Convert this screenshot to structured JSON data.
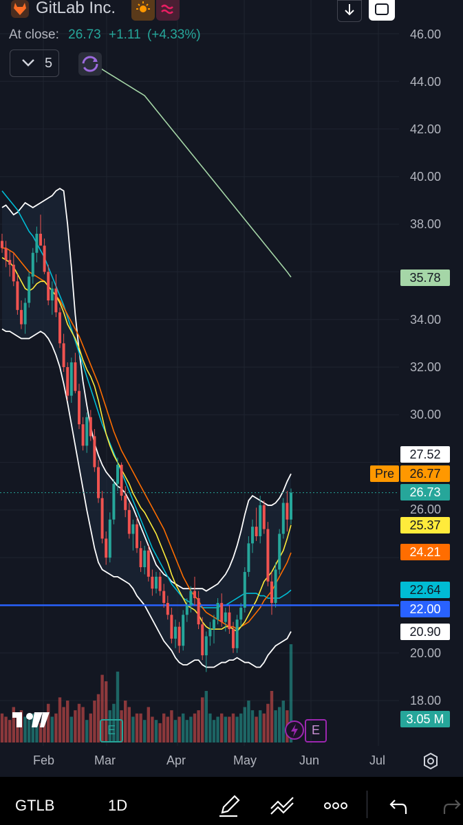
{
  "header": {
    "company": "GitLab Inc.",
    "at_close_label": "At close:",
    "close_price": "26.73",
    "change": "+1.11",
    "change_pct": "(+4.33%)",
    "interval_count": "5",
    "session_icon": "sun-icon",
    "wave_icon": "wave-icon",
    "download_icon": "download-icon",
    "fullscreen_icon": "fullscreen-icon"
  },
  "price_axis": [
    "46.00",
    "44.00",
    "42.00",
    "40.00",
    "38.00",
    "34.00",
    "32.00",
    "30.00",
    "26.00",
    "20.00",
    "18.00"
  ],
  "time_axis": [
    "Feb",
    "Mar",
    "Apr",
    "May",
    "Jun",
    "Jul"
  ],
  "tags": {
    "sma200": "35.78",
    "upper_band": "27.52",
    "pre_label": "Pre",
    "pre_price": "26.77",
    "last": "26.73",
    "ma10": "25.37",
    "ma20": "24.21",
    "ma50": "22.64",
    "hline": "22.00",
    "lower_band": "20.90",
    "volume": "3.05 M"
  },
  "colors": {
    "up": "#26a69a",
    "down": "#ef5350",
    "ma10": "#ffeb3b",
    "ma20": "#ff6d00",
    "ma50": "#00bcd4",
    "sma200": "#a5d6a7",
    "bands": "#ffffff",
    "hline": "#2962ff",
    "pre": "#ff9800",
    "earnings": "#9c27b0"
  },
  "earnings_marker": "E",
  "bottom_bar": {
    "ticker": "GTLB",
    "interval": "1D",
    "icons": [
      "pencil-icon",
      "trend-line-icon",
      "more-icon",
      "undo-icon",
      "redo-icon"
    ]
  },
  "chart_data": {
    "type": "candlestick",
    "ylim": [
      17.0,
      47.0
    ],
    "x_ticks": [
      "Feb",
      "Mar",
      "Apr",
      "May",
      "Jun",
      "Jul"
    ],
    "candles": [
      [
        37.3,
        37.6,
        36.8,
        37.0
      ],
      [
        37.0,
        37.3,
        36.2,
        36.5
      ],
      [
        36.5,
        36.9,
        35.8,
        36.3
      ],
      [
        36.3,
        36.8,
        35.4,
        35.6
      ],
      [
        35.6,
        35.9,
        34.2,
        34.4
      ],
      [
        34.4,
        34.8,
        33.6,
        33.8
      ],
      [
        33.8,
        34.9,
        33.4,
        34.7
      ],
      [
        34.7,
        36.0,
        34.5,
        35.8
      ],
      [
        35.8,
        37.0,
        35.5,
        36.8
      ],
      [
        36.8,
        37.9,
        36.4,
        37.6
      ],
      [
        37.6,
        38.4,
        37.2,
        37.1
      ],
      [
        37.1,
        37.4,
        35.9,
        36.0
      ],
      [
        36.0,
        36.3,
        34.6,
        34.8
      ],
      [
        34.8,
        35.6,
        34.2,
        35.3
      ],
      [
        35.3,
        35.9,
        34.1,
        34.3
      ],
      [
        34.3,
        34.5,
        32.8,
        33.0
      ],
      [
        33.0,
        33.4,
        31.8,
        32.0
      ],
      [
        32.0,
        32.2,
        30.6,
        30.8
      ],
      [
        30.8,
        32.4,
        30.5,
        32.2
      ],
      [
        32.2,
        32.6,
        30.9,
        31.0
      ],
      [
        31.0,
        31.3,
        29.4,
        29.6
      ],
      [
        29.6,
        29.9,
        28.5,
        28.7
      ],
      [
        28.7,
        30.1,
        28.4,
        29.9
      ],
      [
        29.9,
        30.2,
        28.9,
        29.1
      ],
      [
        29.1,
        29.4,
        27.6,
        27.8
      ],
      [
        27.8,
        28.1,
        26.3,
        26.5
      ],
      [
        26.5,
        26.8,
        24.6,
        24.8
      ],
      [
        24.8,
        25.1,
        23.7,
        24.0
      ],
      [
        24.0,
        25.9,
        23.8,
        25.6
      ],
      [
        25.6,
        27.3,
        25.4,
        27.1
      ],
      [
        27.1,
        28.2,
        26.8,
        27.9
      ],
      [
        27.9,
        28.0,
        26.4,
        26.6
      ],
      [
        26.6,
        27.0,
        25.7,
        26.0
      ],
      [
        26.0,
        26.3,
        24.8,
        25.0
      ],
      [
        25.0,
        25.6,
        24.3,
        25.4
      ],
      [
        25.4,
        25.7,
        24.2,
        24.4
      ],
      [
        24.4,
        24.7,
        23.4,
        23.6
      ],
      [
        23.6,
        24.5,
        23.3,
        24.3
      ],
      [
        24.3,
        24.5,
        23.0,
        23.2
      ],
      [
        23.2,
        23.5,
        22.4,
        22.7
      ],
      [
        22.7,
        23.4,
        22.5,
        23.2
      ],
      [
        23.2,
        23.4,
        22.4,
        22.6
      ],
      [
        22.6,
        22.9,
        21.9,
        22.1
      ],
      [
        22.1,
        22.4,
        21.4,
        21.6
      ],
      [
        21.6,
        21.9,
        20.4,
        20.6
      ],
      [
        20.6,
        21.4,
        20.2,
        21.1
      ],
      [
        21.1,
        21.3,
        20.0,
        20.3
      ],
      [
        20.3,
        21.8,
        20.1,
        21.6
      ],
      [
        21.6,
        22.3,
        21.3,
        22.0
      ],
      [
        22.0,
        22.8,
        21.7,
        22.6
      ],
      [
        22.6,
        23.2,
        22.0,
        22.3
      ],
      [
        22.3,
        22.6,
        21.0,
        21.2
      ],
      [
        21.2,
        21.5,
        19.7,
        19.9
      ],
      [
        19.9,
        20.9,
        19.2,
        20.7
      ],
      [
        20.7,
        21.3,
        20.3,
        21.0
      ],
      [
        21.0,
        21.6,
        20.4,
        21.4
      ],
      [
        21.4,
        22.3,
        21.2,
        22.1
      ],
      [
        22.1,
        22.5,
        21.1,
        21.3
      ],
      [
        21.3,
        21.9,
        20.9,
        21.7
      ],
      [
        21.7,
        22.0,
        20.8,
        21.0
      ],
      [
        21.0,
        21.3,
        20.0,
        20.2
      ],
      [
        20.2,
        21.6,
        20.0,
        21.4
      ],
      [
        21.4,
        22.1,
        21.1,
        21.9
      ],
      [
        21.9,
        23.6,
        21.7,
        23.4
      ],
      [
        23.4,
        24.9,
        23.2,
        24.6
      ],
      [
        24.6,
        25.6,
        24.2,
        25.3
      ],
      [
        25.3,
        26.1,
        24.7,
        24.9
      ],
      [
        24.9,
        26.6,
        24.6,
        26.2
      ],
      [
        26.2,
        26.4,
        25.0,
        25.2
      ],
      [
        25.2,
        25.5,
        22.8,
        23.0
      ],
      [
        23.0,
        23.4,
        21.6,
        22.1
      ],
      [
        22.1,
        23.8,
        21.9,
        23.5
      ],
      [
        23.5,
        25.2,
        23.3,
        25.0
      ],
      [
        25.0,
        26.5,
        24.8,
        26.3
      ],
      [
        26.3,
        26.8,
        25.1,
        25.6
      ],
      [
        25.6,
        26.9,
        25.4,
        26.73
      ]
    ],
    "volume": [
      0.9,
      0.8,
      0.7,
      1.1,
      0.9,
      1.0,
      0.8,
      0.7,
      0.9,
      0.8,
      0.6,
      0.9,
      1.2,
      0.8,
      0.9,
      1.4,
      1.1,
      1.3,
      0.8,
      1.0,
      1.2,
      1.1,
      0.7,
      0.9,
      1.3,
      1.5,
      2.1,
      1.9,
      1.0,
      1.2,
      2.2,
      1.0,
      1.3,
      1.1,
      0.8,
      0.9,
      0.9,
      0.7,
      1.1,
      0.8,
      0.7,
      0.6,
      0.9,
      0.8,
      1.0,
      0.7,
      0.8,
      0.9,
      0.7,
      0.8,
      0.9,
      1.0,
      1.4,
      1.6,
      0.9,
      0.7,
      0.8,
      0.9,
      0.8,
      0.8,
      0.9,
      0.8,
      0.9,
      1.1,
      1.3,
      1.0,
      0.8,
      1.0,
      0.9,
      1.2,
      1.6,
      1.0,
      1.1,
      1.3,
      1.0,
      3.05
    ],
    "vol_max": 3.2,
    "ma10": [
      36.6,
      36.5,
      36.4,
      36.2,
      35.9,
      35.6,
      35.3,
      35.2,
      35.3,
      35.5,
      35.6,
      35.6,
      35.4,
      35.2,
      35.0,
      34.7,
      34.3,
      33.8,
      33.5,
      33.2,
      32.8,
      32.3,
      31.9,
      31.6,
      31.2,
      30.6,
      29.9,
      29.2,
      28.7,
      28.3,
      28.0,
      27.7,
      27.4,
      27.1,
      26.7,
      26.4,
      26.1,
      25.9,
      25.6,
      25.3,
      25.0,
      24.6,
      24.2,
      23.8,
      23.3,
      22.9,
      22.6,
      22.3,
      22.0,
      21.9,
      21.8,
      21.6,
      21.3,
      21.1,
      21.0,
      21.0,
      21.0,
      21.0,
      21.1,
      21.1,
      21.0,
      20.9,
      21.1,
      21.3,
      21.6,
      21.9,
      22.2,
      22.6,
      23.0,
      23.2,
      23.4,
      23.7,
      24.0,
      24.3,
      24.8,
      25.37
    ],
    "ma20": [
      37.0,
      37.0,
      36.9,
      36.8,
      36.6,
      36.4,
      36.2,
      36.0,
      35.9,
      35.8,
      35.7,
      35.6,
      35.4,
      35.2,
      35.0,
      34.8,
      34.5,
      34.2,
      33.9,
      33.6,
      33.3,
      32.9,
      32.5,
      32.1,
      31.7,
      31.3,
      30.8,
      30.3,
      29.8,
      29.3,
      28.9,
      28.5,
      28.2,
      27.9,
      27.6,
      27.3,
      27.0,
      26.7,
      26.4,
      26.1,
      25.8,
      25.5,
      25.2,
      24.8,
      24.4,
      24.0,
      23.6,
      23.2,
      22.9,
      22.6,
      22.4,
      22.2,
      21.9,
      21.7,
      21.6,
      21.5,
      21.4,
      21.3,
      21.2,
      21.1,
      21.1,
      21.0,
      21.1,
      21.2,
      21.3,
      21.5,
      21.7,
      21.9,
      22.2,
      22.4,
      22.6,
      22.9,
      23.2,
      23.5,
      23.8,
      24.21
    ],
    "ma50": [
      39.4,
      39.2,
      39.0,
      38.8,
      38.6,
      38.3,
      38.0,
      37.7,
      37.5,
      37.2,
      36.9,
      36.6,
      36.2,
      35.8,
      35.4,
      35.0,
      34.6,
      34.1,
      33.6,
      33.1,
      32.6,
      32.1,
      31.6,
      31.1,
      30.6,
      30.1,
      29.6,
      29.2,
      28.8,
      28.4,
      28.0,
      27.6,
      27.2,
      26.8,
      26.4,
      26.0,
      25.6,
      25.2,
      24.8,
      24.4,
      24.1,
      23.8,
      23.5,
      23.2,
      22.9,
      22.7,
      22.5,
      22.3,
      22.2,
      22.1,
      22.0,
      22.0,
      21.9,
      21.9,
      21.9,
      21.9,
      21.9,
      22.0,
      22.0,
      22.1,
      22.2,
      22.3,
      22.4,
      22.5,
      22.5,
      22.5,
      22.5,
      22.4,
      22.4,
      22.3,
      22.3,
      22.3,
      22.3,
      22.4,
      22.5,
      22.64
    ],
    "upper": [
      38.7,
      38.8,
      38.6,
      38.4,
      38.5,
      38.7,
      38.9,
      38.8,
      38.7,
      38.8,
      38.9,
      39.0,
      39.1,
      39.2,
      39.4,
      39.5,
      39.4,
      38.0,
      36.2,
      34.2,
      32.7,
      31.4,
      30.4,
      29.5,
      28.8,
      28.3,
      27.9,
      27.6,
      27.4,
      27.2,
      27.0,
      26.9,
      26.7,
      26.4,
      26.1,
      25.7,
      25.3,
      24.9,
      24.5,
      24.1,
      23.7,
      23.5,
      23.3,
      23.2,
      23.0,
      22.9,
      22.8,
      22.7,
      22.7,
      22.7,
      22.7,
      22.7,
      22.7,
      22.6,
      22.7,
      22.8,
      22.9,
      23.1,
      23.3,
      23.6,
      24.0,
      24.5,
      25.1,
      25.8,
      26.4,
      26.6,
      26.5,
      26.4,
      26.3,
      26.2,
      26.2,
      26.3,
      26.5,
      26.8,
      27.2,
      27.52
    ],
    "lower": [
      33.6,
      33.5,
      33.5,
      33.4,
      33.3,
      33.2,
      33.2,
      33.2,
      33.3,
      33.4,
      33.5,
      33.4,
      33.2,
      32.9,
      32.5,
      32.0,
      31.3,
      30.5,
      29.6,
      28.7,
      27.8,
      26.9,
      26.0,
      25.2,
      24.4,
      23.8,
      23.5,
      23.4,
      23.3,
      23.2,
      23.2,
      23.1,
      23.0,
      22.9,
      22.7,
      22.4,
      22.2,
      22.0,
      21.7,
      21.4,
      21.1,
      20.8,
      20.5,
      20.3,
      20.1,
      19.8,
      19.6,
      19.5,
      19.5,
      19.6,
      19.7,
      19.7,
      19.5,
      19.4,
      19.4,
      19.4,
      19.5,
      19.6,
      19.6,
      19.7,
      19.7,
      19.8,
      19.7,
      19.6,
      19.6,
      19.5,
      19.4,
      19.4,
      19.6,
      19.9,
      20.1,
      20.3,
      20.4,
      20.5,
      20.6,
      20.9
    ],
    "sma200": [
      44.6,
      44.5,
      44.4,
      44.3,
      44.2,
      44.1,
      44.0,
      43.9,
      43.8,
      43.7,
      43.6,
      43.5,
      43.4,
      43.2,
      43.0,
      42.8,
      42.6,
      42.4,
      42.2,
      42.0,
      41.8,
      41.6,
      41.4,
      41.2,
      41.0,
      40.8,
      40.6,
      40.4,
      40.2,
      40.0,
      39.8,
      39.6,
      39.4,
      39.2,
      39.0,
      38.8,
      38.6,
      38.4,
      38.2,
      38.0,
      37.8,
      37.6,
      37.4,
      37.2,
      37.0,
      36.8,
      36.6,
      36.4,
      36.2,
      36.0,
      35.78
    ],
    "hline": 22.0,
    "last_price": 26.73
  }
}
